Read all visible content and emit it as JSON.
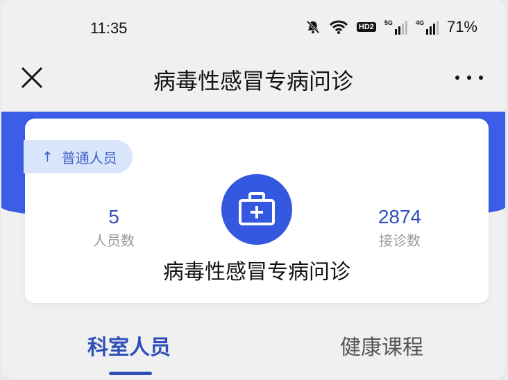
{
  "status_bar": {
    "time": "11:35",
    "hd_label": "HD2",
    "net1": "5G",
    "net2": "4G",
    "battery": "71%"
  },
  "header": {
    "title": "病毒性感冒专病问诊"
  },
  "card": {
    "badge_arrow": "↑",
    "badge_label": "普通人员",
    "staff_count": "5",
    "staff_label": "人员数",
    "visits_count": "2874",
    "visits_label": "接诊数",
    "title": "病毒性感冒专病问诊"
  },
  "tabs": [
    {
      "label": "科室人员"
    },
    {
      "label": "健康课程"
    }
  ],
  "colors": {
    "accent": "#3b5de7",
    "text_accent": "#2f4fb8",
    "badge_bg": "#d9e5fb"
  }
}
